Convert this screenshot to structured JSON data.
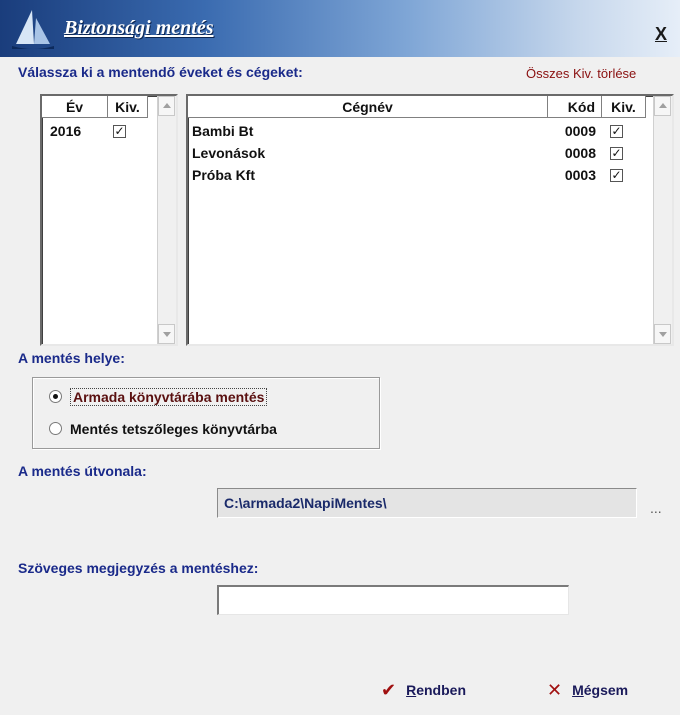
{
  "window": {
    "title": "Biztonsági mentés",
    "close_label": "X"
  },
  "select_label": "Válassza ki a mentendő éveket és cégeket:",
  "clear_selection_link": "Összes Kiv. törlése",
  "years_table": {
    "columns": [
      "Év",
      "Kiv."
    ],
    "rows": [
      {
        "year": "2016",
        "checked": true
      }
    ]
  },
  "companies_table": {
    "columns": [
      "Cégnév",
      "Kód",
      "Kiv."
    ],
    "rows": [
      {
        "name": "Bambi Bt",
        "code": "0009",
        "checked": true
      },
      {
        "name": "Levonások",
        "code": "0008",
        "checked": true
      },
      {
        "name": "Próba Kft",
        "code": "0003",
        "checked": true
      }
    ]
  },
  "location": {
    "label": "A mentés helye:",
    "options": [
      {
        "label": "Armada könyvtárába mentés",
        "selected": true
      },
      {
        "label": "Mentés tetszőleges könyvtárba",
        "selected": false
      }
    ]
  },
  "path": {
    "label": "A mentés útvonala:",
    "value": "C:\\armada2\\NapiMentes\\",
    "browse_label": "..."
  },
  "note": {
    "label": "Szöveges megjegyzés a mentéshez:",
    "value": ""
  },
  "buttons": {
    "ok": {
      "hotkey": "R",
      "rest": "endben",
      "icon": "✔"
    },
    "cancel": {
      "hotkey": "M",
      "rest": "égsem",
      "icon": "✕"
    }
  },
  "colors": {
    "label_blue": "#1a2a8a",
    "link_red": "#8a1010",
    "title_gradient_start": "#1a3d7c"
  }
}
